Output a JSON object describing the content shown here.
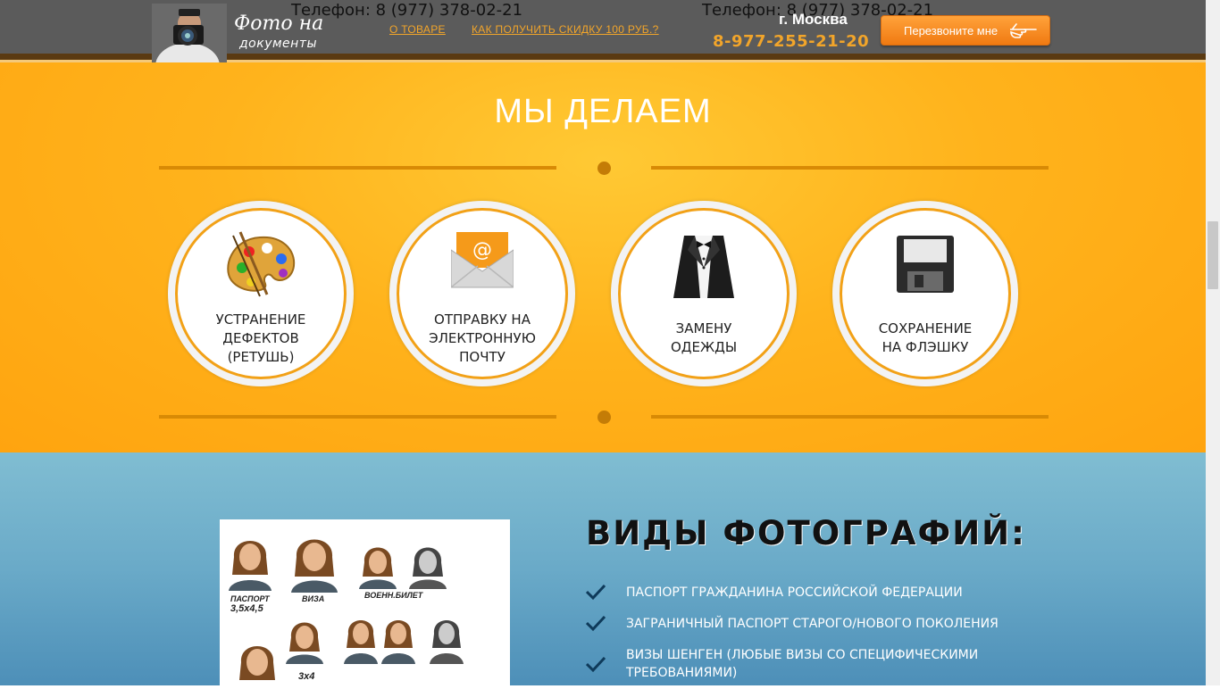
{
  "header": {
    "logo_line1": "Фото на",
    "logo_line2": "документы",
    "phone_left": "Телефон: 8 (977) 378-02-21",
    "phone_right": "Телефон: 8 (977) 378-02-21",
    "nav": [
      {
        "label": "О ТОВАРЕ"
      },
      {
        "label": "КАК ПОЛУЧИТЬ СКИДКУ 100 РУБ.?"
      }
    ],
    "city": "г. Москва",
    "phone_main": "8-977-255-21-20",
    "callback_label": "Перезвоните мне"
  },
  "services": {
    "title": "МЫ ДЕЛАЕМ",
    "items": [
      {
        "line1": "УСТРАНЕНИЕ",
        "line2": "ДЕФЕКТОВ",
        "line3": "(РЕТУШЬ)",
        "icon": "palette-icon"
      },
      {
        "line1": "ОТПРАВКУ НА",
        "line2": "ЭЛЕКТРОННУЮ",
        "line3": "ПОЧТУ",
        "icon": "email-envelope-icon"
      },
      {
        "line1": "ЗАМЕНУ",
        "line2": "ОДЕЖДЫ",
        "icon": "tuxedo-icon"
      },
      {
        "line1": "СОХРАНЕНИЕ",
        "line2": "НА ФЛЭШКУ",
        "icon": "floppy-disk-icon"
      }
    ]
  },
  "photo_types": {
    "title": "ВИДЫ ФОТОГРАФИЙ:",
    "sheet_labels": {
      "passport": "ПАСПОРТ",
      "passport_size": "3,5x4,5",
      "visa": "ВИЗА",
      "military": "ВОЕНН.БИЛЕТ",
      "small": "3x4"
    },
    "items": [
      {
        "text": "ПАСПОРТ ГРАЖДАНИНА РОССИЙСКОЙ ФЕДЕРАЦИИ"
      },
      {
        "text": "ЗАГРАНИЧНЫЙ ПАСПОРТ СТАРОГО/НОВОГО ПОКОЛЕНИЯ"
      },
      {
        "text": "ВИЗЫ ШЕНГЕН (ЛЮБЫЕ ВИЗЫ СО СПЕЦИФИЧЕСКИМИ ТРЕБОВАНИЯМИ)"
      }
    ]
  },
  "colors": {
    "accent_orange": "#f2a52a",
    "header_bg": "#5b5b5b",
    "section_orange": "#ffb31c",
    "section_blue": "#6aaac8"
  }
}
